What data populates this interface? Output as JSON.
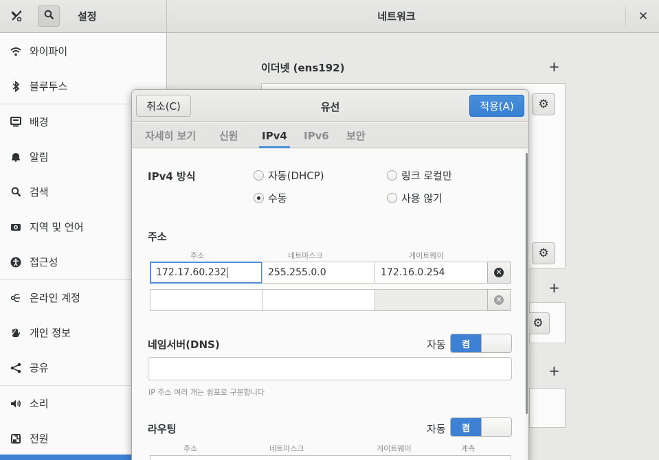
{
  "header": {
    "settings_title": "설정",
    "page_title": "네트워크",
    "close_glyph": "✕"
  },
  "sidebar": {
    "items": [
      {
        "label": "와이파이",
        "icon": "wifi-icon"
      },
      {
        "label": "블루투스",
        "icon": "bluetooth-icon"
      },
      {
        "label": "배경",
        "icon": "display-icon"
      },
      {
        "label": "알림",
        "icon": "bell-icon"
      },
      {
        "label": "검색",
        "icon": "search-icon"
      },
      {
        "label": "지역 및 언어",
        "icon": "camera-icon"
      },
      {
        "label": "접근성",
        "icon": "accessibility-icon"
      },
      {
        "label": "온라인 계정",
        "icon": "online-accounts-icon"
      },
      {
        "label": "개인 정보",
        "icon": "hand-icon"
      },
      {
        "label": "공유",
        "icon": "share-icon"
      },
      {
        "label": "소리",
        "icon": "speaker-icon"
      },
      {
        "label": "전원",
        "icon": "power-icon"
      }
    ]
  },
  "main": {
    "ethernet_title": "이더넷 (ens192)"
  },
  "dialog": {
    "cancel_label": "취소(C)",
    "title": "유선",
    "apply_label": "적용(A)",
    "tabs": [
      {
        "label": "자세히 보기"
      },
      {
        "label": "신원"
      },
      {
        "label": "IPv4"
      },
      {
        "label": "IPv6"
      },
      {
        "label": "보안"
      }
    ],
    "active_tab": "IPv4",
    "ipv4_method_label": "IPv4 방식",
    "methods": [
      {
        "label": "자동(DHCP)",
        "checked": false
      },
      {
        "label": "링크 로컬만",
        "checked": false
      },
      {
        "label": "수동",
        "checked": true
      },
      {
        "label": "사용 않기",
        "checked": false
      }
    ],
    "address_section_label": "주소",
    "address_columns": [
      "주소",
      "네트마스크",
      "게이트웨이"
    ],
    "address_rows": [
      {
        "address": "172.17.60.232",
        "netmask": "255.255.0.0",
        "gateway": "172.16.0.254"
      },
      {
        "address": "",
        "netmask": "",
        "gateway": ""
      }
    ],
    "dns_label": "네임서버(DNS)",
    "dns_auto_label": "자동",
    "dns_switch_label": "켬",
    "dns_value": "",
    "dns_hint": "IP 주소 여러 개는 쉼표로 구분합니다",
    "routing_label": "라우팅",
    "routing_auto_label": "자동",
    "routing_switch_label": "켬",
    "routing_columns": [
      "주소",
      "네트마스크",
      "게이트웨이",
      "계측"
    ]
  },
  "colors": {
    "accent": "#3c81d3",
    "apply_button": "#4a90d9"
  }
}
